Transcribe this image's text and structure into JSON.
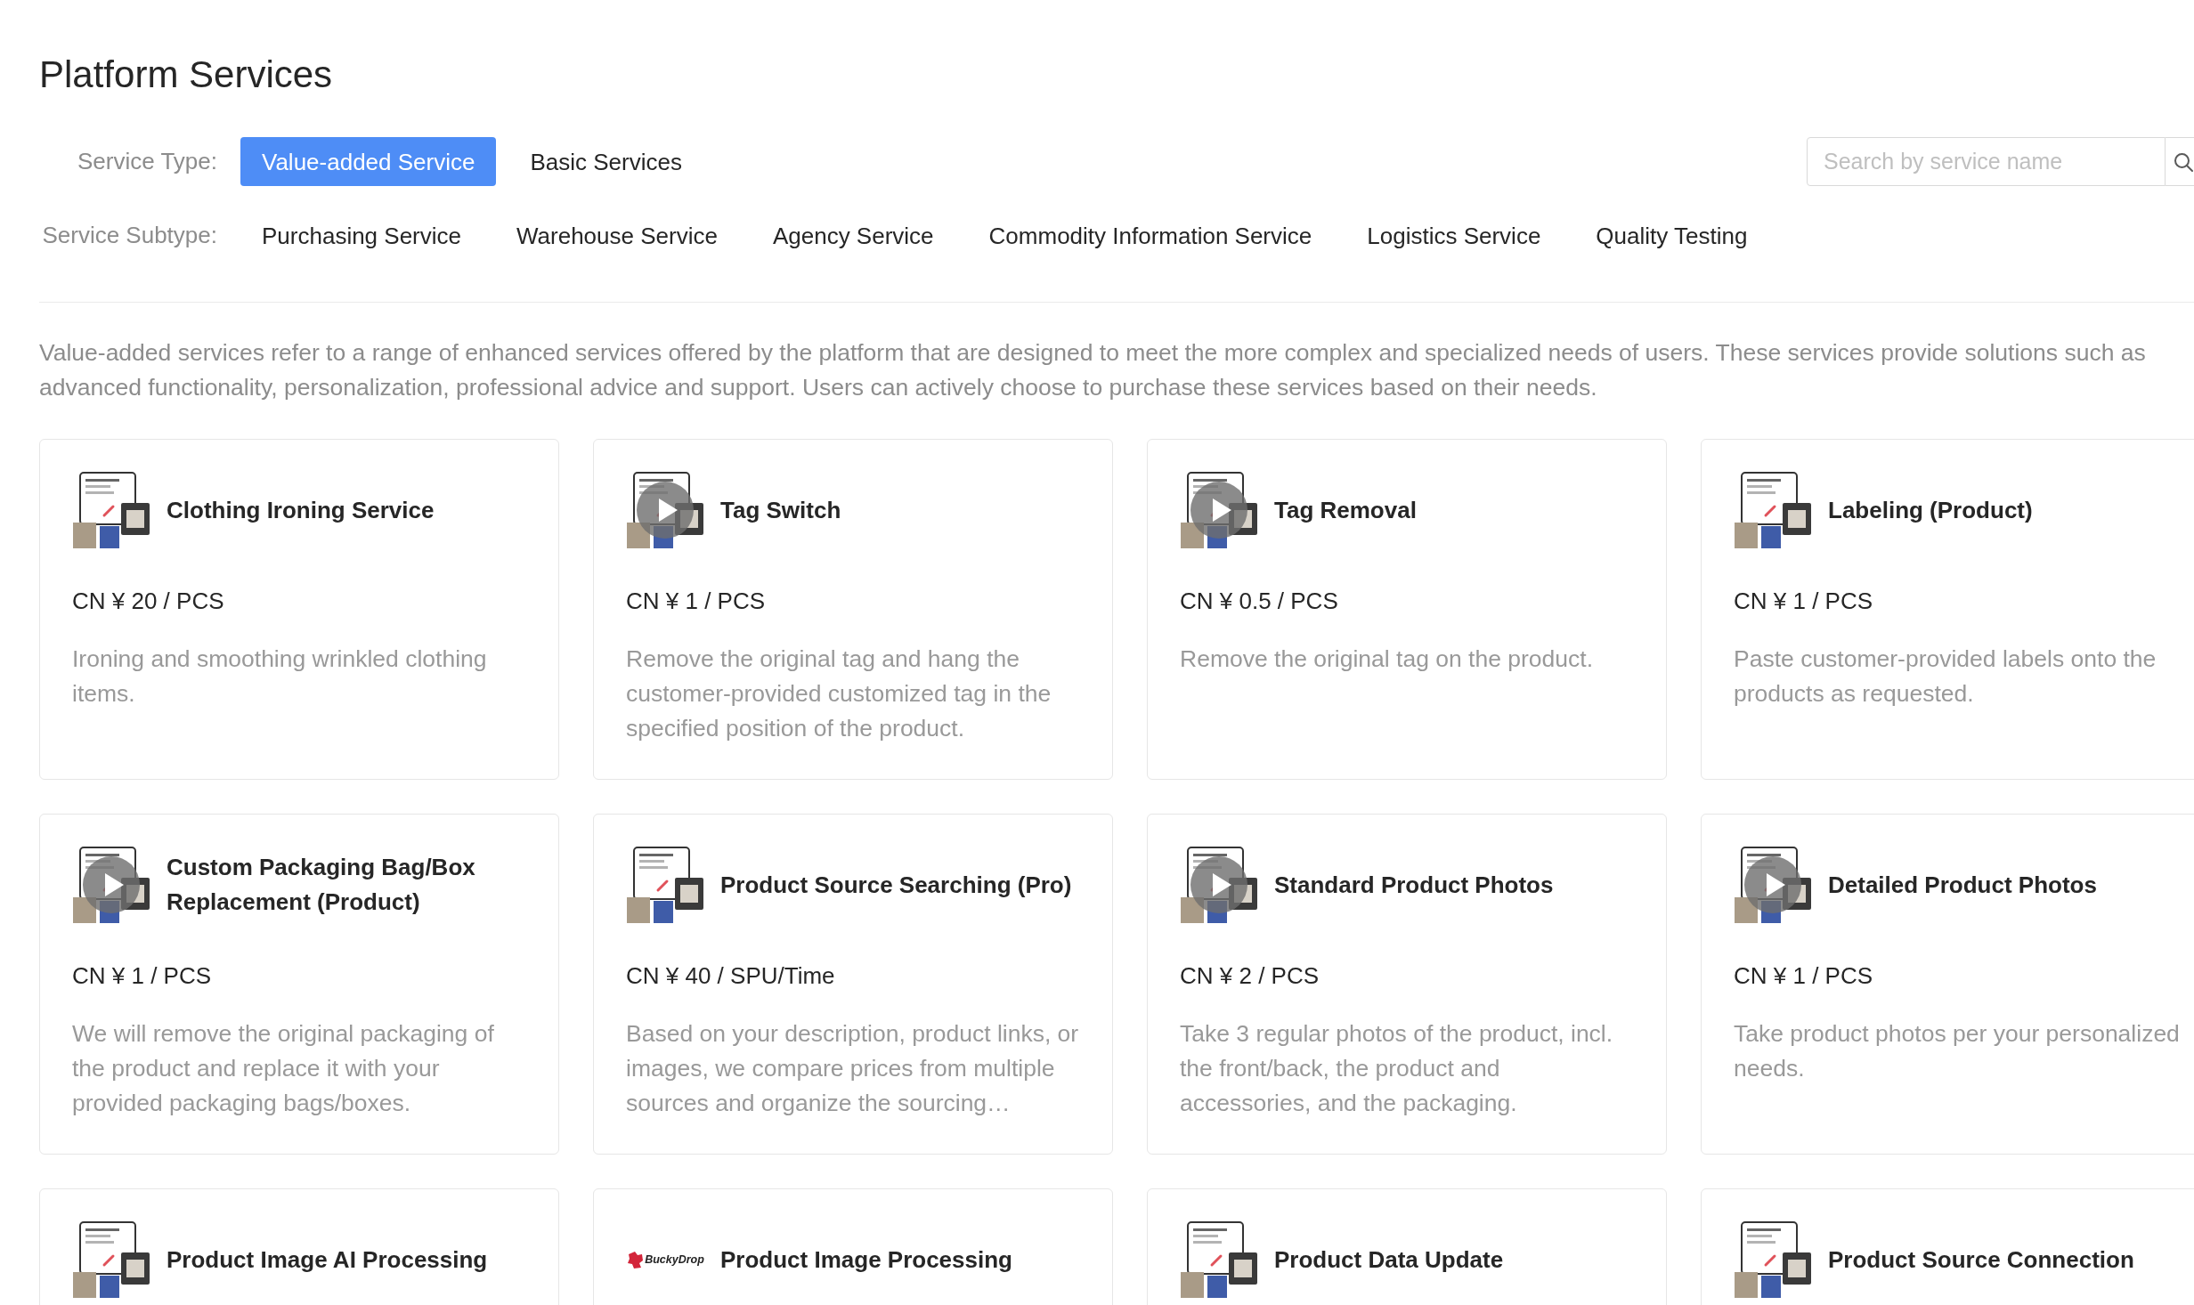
{
  "page": {
    "title": "Platform Services"
  },
  "filters": {
    "service_type": {
      "label": "Service Type:",
      "options": [
        {
          "label": "Value-added Service",
          "selected": true
        },
        {
          "label": "Basic Services",
          "selected": false
        }
      ]
    },
    "service_subtype": {
      "label": "Service Subtype:",
      "options": [
        {
          "label": "Purchasing Service",
          "selected": false
        },
        {
          "label": "Warehouse Service",
          "selected": false
        },
        {
          "label": "Agency Service",
          "selected": false
        },
        {
          "label": "Commodity Information Service",
          "selected": false
        },
        {
          "label": "Logistics Service",
          "selected": false
        },
        {
          "label": "Quality Testing",
          "selected": false
        }
      ]
    }
  },
  "search": {
    "placeholder": "Search by service name"
  },
  "description": "Value-added services refer to a range of enhanced services offered by the platform that are designed to meet the more complex and specialized needs of users. These services provide solutions such as advanced functionality, personalization, professional advice and support. Users can actively choose to purchase these services based on their needs.",
  "cards": [
    {
      "title": "Clothing Ironing Service",
      "thumbnail": {
        "kind": "image",
        "video": false
      },
      "price": "CN ¥ 20 / PCS",
      "description": "Ironing and smoothing wrinkled clothing items."
    },
    {
      "title": "Tag Switch",
      "thumbnail": {
        "kind": "image",
        "video": true
      },
      "price": "CN ¥ 1 / PCS",
      "description": "Remove the original tag and hang the customer-provided customized tag in the specified position of the product."
    },
    {
      "title": "Tag Removal",
      "thumbnail": {
        "kind": "image",
        "video": true
      },
      "price": "CN ¥ 0.5 / PCS",
      "description": "Remove the original tag on the product."
    },
    {
      "title": "Labeling (Product)",
      "thumbnail": {
        "kind": "image",
        "video": false
      },
      "price": "CN ¥ 1 / PCS",
      "description": "Paste customer-provided labels onto the products as requested."
    },
    {
      "title": "Custom Packaging Bag/Box Replacement (Product)",
      "thumbnail": {
        "kind": "image",
        "video": true
      },
      "price": "CN ¥ 1 / PCS",
      "description": "We will remove the original packaging of the product and replace it with your provided packaging bags/boxes."
    },
    {
      "title": "Product Source Searching (Pro)",
      "thumbnail": {
        "kind": "image",
        "video": false
      },
      "price": "CN ¥ 40 / SPU/Time",
      "description": "Based on your description, product links, or images, we compare prices from multiple sources and organize the sourcing…"
    },
    {
      "title": "Standard Product Photos",
      "thumbnail": {
        "kind": "image",
        "video": true
      },
      "price": "CN ¥ 2 / PCS",
      "description": "Take 3 regular photos of the product, incl. the front/back, the product and accessories, and the packaging."
    },
    {
      "title": "Detailed Product Photos",
      "thumbnail": {
        "kind": "image",
        "video": true
      },
      "price": "CN ¥ 1 / PCS",
      "description": "Take product photos per your personalized needs."
    },
    {
      "title": "Product Image AI Processing",
      "thumbnail": {
        "kind": "image",
        "video": false
      }
    },
    {
      "title": "Product Image Processing",
      "thumbnail": {
        "kind": "logo",
        "text": "BuckyDrop"
      }
    },
    {
      "title": "Product Data Update",
      "thumbnail": {
        "kind": "image",
        "video": false
      }
    },
    {
      "title": "Product Source Connection",
      "thumbnail": {
        "kind": "image",
        "video": false
      }
    }
  ]
}
